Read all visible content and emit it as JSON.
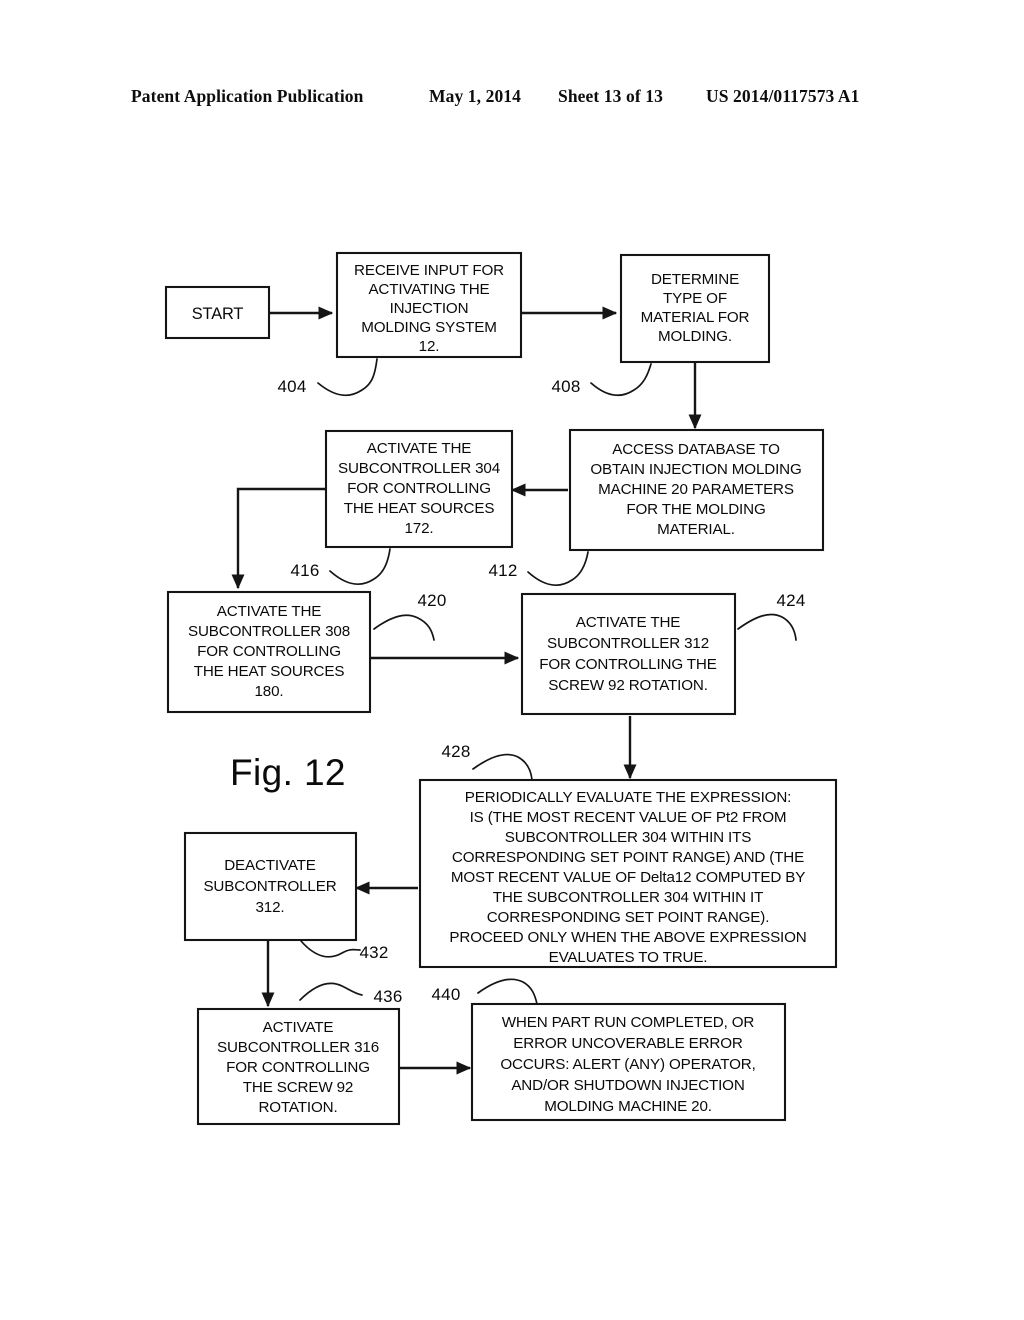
{
  "header": {
    "publication": "Patent Application Publication",
    "date": "May 1, 2014",
    "sheet": "Sheet 13 of 13",
    "patent_number": "US 2014/0117573 A1"
  },
  "figure": {
    "label": "Fig. 12",
    "nodes": [
      {
        "id": "start",
        "name": "start-node",
        "ref": "",
        "lines": [
          "START"
        ]
      },
      {
        "id": "receive-input",
        "name": "receive-input-node",
        "ref": "404",
        "lines": [
          "RECEIVE INPUT FOR",
          "ACTIVATING THE",
          "INJECTION",
          "MOLDING SYSTEM",
          "12."
        ]
      },
      {
        "id": "determine-material",
        "name": "determine-material-node",
        "ref": "408",
        "lines": [
          "DETERMINE",
          "TYPE OF",
          "MATERIAL FOR",
          "MOLDING."
        ]
      },
      {
        "id": "access-database",
        "name": "access-database-node",
        "ref": "412",
        "lines": [
          "ACCESS DATABASE TO",
          "OBTAIN INJECTION MOLDING",
          "MACHINE 20 PARAMETERS",
          "FOR THE MOLDING",
          "MATERIAL."
        ]
      },
      {
        "id": "activate-304",
        "name": "activate-subcontroller-304-node",
        "ref": "416",
        "lines": [
          "ACTIVATE THE",
          "SUBCONTROLLER 304",
          "FOR CONTROLLING",
          "THE HEAT SOURCES",
          "172."
        ]
      },
      {
        "id": "activate-308",
        "name": "activate-subcontroller-308-node",
        "ref": "420",
        "lines": [
          "ACTIVATE THE",
          "SUBCONTROLLER 308",
          "FOR CONTROLLING",
          "THE HEAT SOURCES",
          "180."
        ]
      },
      {
        "id": "activate-312",
        "name": "activate-subcontroller-312-node",
        "ref": "424",
        "lines": [
          "ACTIVATE THE",
          "SUBCONTROLLER 312",
          "FOR CONTROLLING THE",
          "SCREW 92 ROTATION."
        ]
      },
      {
        "id": "evaluate-expression",
        "name": "evaluate-expression-node",
        "ref": "428",
        "lines": [
          "PERIODICALLY EVALUATE THE EXPRESSION:",
          "IS (THE MOST RECENT VALUE OF Pt2 FROM",
          "SUBCONTROLLER 304 WITHIN ITS",
          "CORRESPONDING SET POINT RANGE) AND (THE",
          "MOST RECENT VALUE OF Delta12 COMPUTED BY",
          "THE SUBCONTROLLER 304 WITHIN IT",
          "CORRESPONDING SET POINT RANGE).",
          "PROCEED ONLY WHEN THE ABOVE EXPRESSION",
          "EVALUATES TO TRUE."
        ]
      },
      {
        "id": "deactivate-312",
        "name": "deactivate-subcontroller-312-node",
        "ref": "432",
        "lines": [
          "DEACTIVATE",
          "SUBCONTROLLER",
          "312."
        ]
      },
      {
        "id": "activate-316",
        "name": "activate-subcontroller-316-node",
        "ref": "436",
        "lines": [
          "ACTIVATE",
          "SUBCONTROLLER 316",
          "FOR CONTROLLING",
          "THE SCREW 92",
          "ROTATION."
        ]
      },
      {
        "id": "part-run-complete",
        "name": "part-run-complete-node",
        "ref": "440",
        "lines": [
          "WHEN PART RUN COMPLETED, OR",
          "ERROR UNCOVERABLE ERROR",
          "OCCURS: ALERT (ANY) OPERATOR,",
          "AND/OR  SHUTDOWN INJECTION",
          "MOLDING MACHINE 20."
        ]
      }
    ],
    "reference_numerals": [
      "404",
      "408",
      "412",
      "416",
      "420",
      "424",
      "428",
      "432",
      "436",
      "440"
    ]
  },
  "colors": {
    "ink": "#0a0a0a",
    "paper": "#ffffff",
    "stroke": "#151515"
  }
}
